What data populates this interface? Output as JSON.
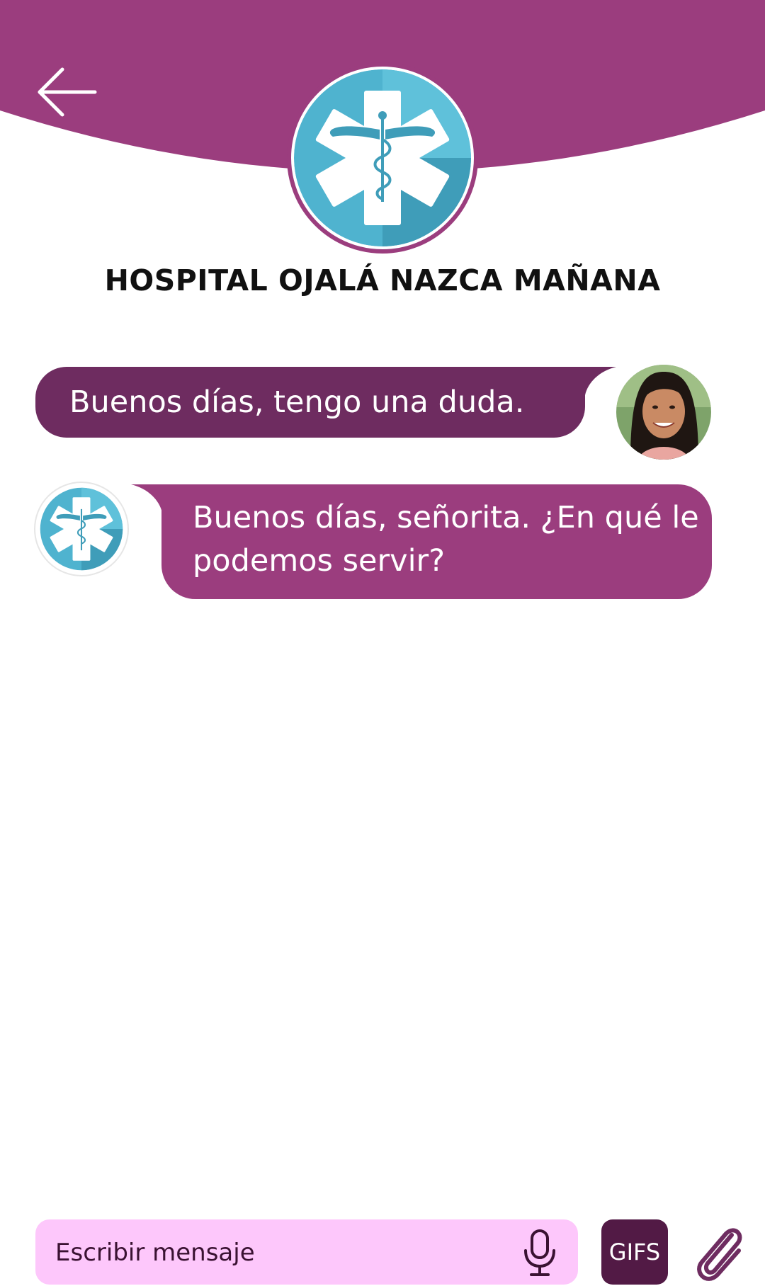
{
  "header": {
    "back_icon": "arrow-left-icon",
    "logo_icon": "star-of-life-caduceus-icon",
    "hospital_name": "HOSPITAL OJALÁ NAZCA MAÑANA"
  },
  "messages": [
    {
      "sender": "user",
      "text": "Buenos días, tengo una duda.",
      "avatar": "user-avatar"
    },
    {
      "sender": "hospital",
      "text": "Buenos días, señorita. ¿En qué le podemos servir?",
      "avatar": "hospital-logo-avatar"
    }
  ],
  "composer": {
    "placeholder": "Escribir mensaje",
    "mic_icon": "microphone-icon",
    "gifs_label": "GIFS",
    "attach_icon": "paperclip-icon"
  },
  "colors": {
    "header": "#9b3d7e",
    "user_bubble": "#6e2c60",
    "bot_bubble": "#9b3d7e",
    "composer_bg": "#fdc7fb",
    "gifs_bg": "#521a45"
  }
}
